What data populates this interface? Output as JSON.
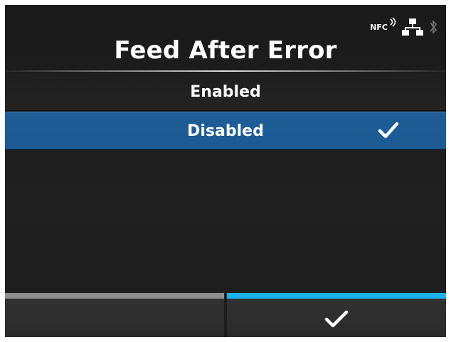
{
  "status": {
    "nfc_label": "NFC",
    "icons": [
      "nfc-icon",
      "network-icon",
      "bluetooth-icon"
    ]
  },
  "title": "Feed After Error",
  "options": [
    {
      "label": "Enabled",
      "selected": false
    },
    {
      "label": "Disabled",
      "selected": true
    }
  ],
  "softkeys": {
    "left": {
      "label": "",
      "accent": "#8e8e8e"
    },
    "right": {
      "icon": "checkmark-icon",
      "accent": "#1ab2ee"
    }
  },
  "colors": {
    "selection": "#1b5a93",
    "accent_blue": "#1ab2ee",
    "background": "#1f1f1f"
  }
}
